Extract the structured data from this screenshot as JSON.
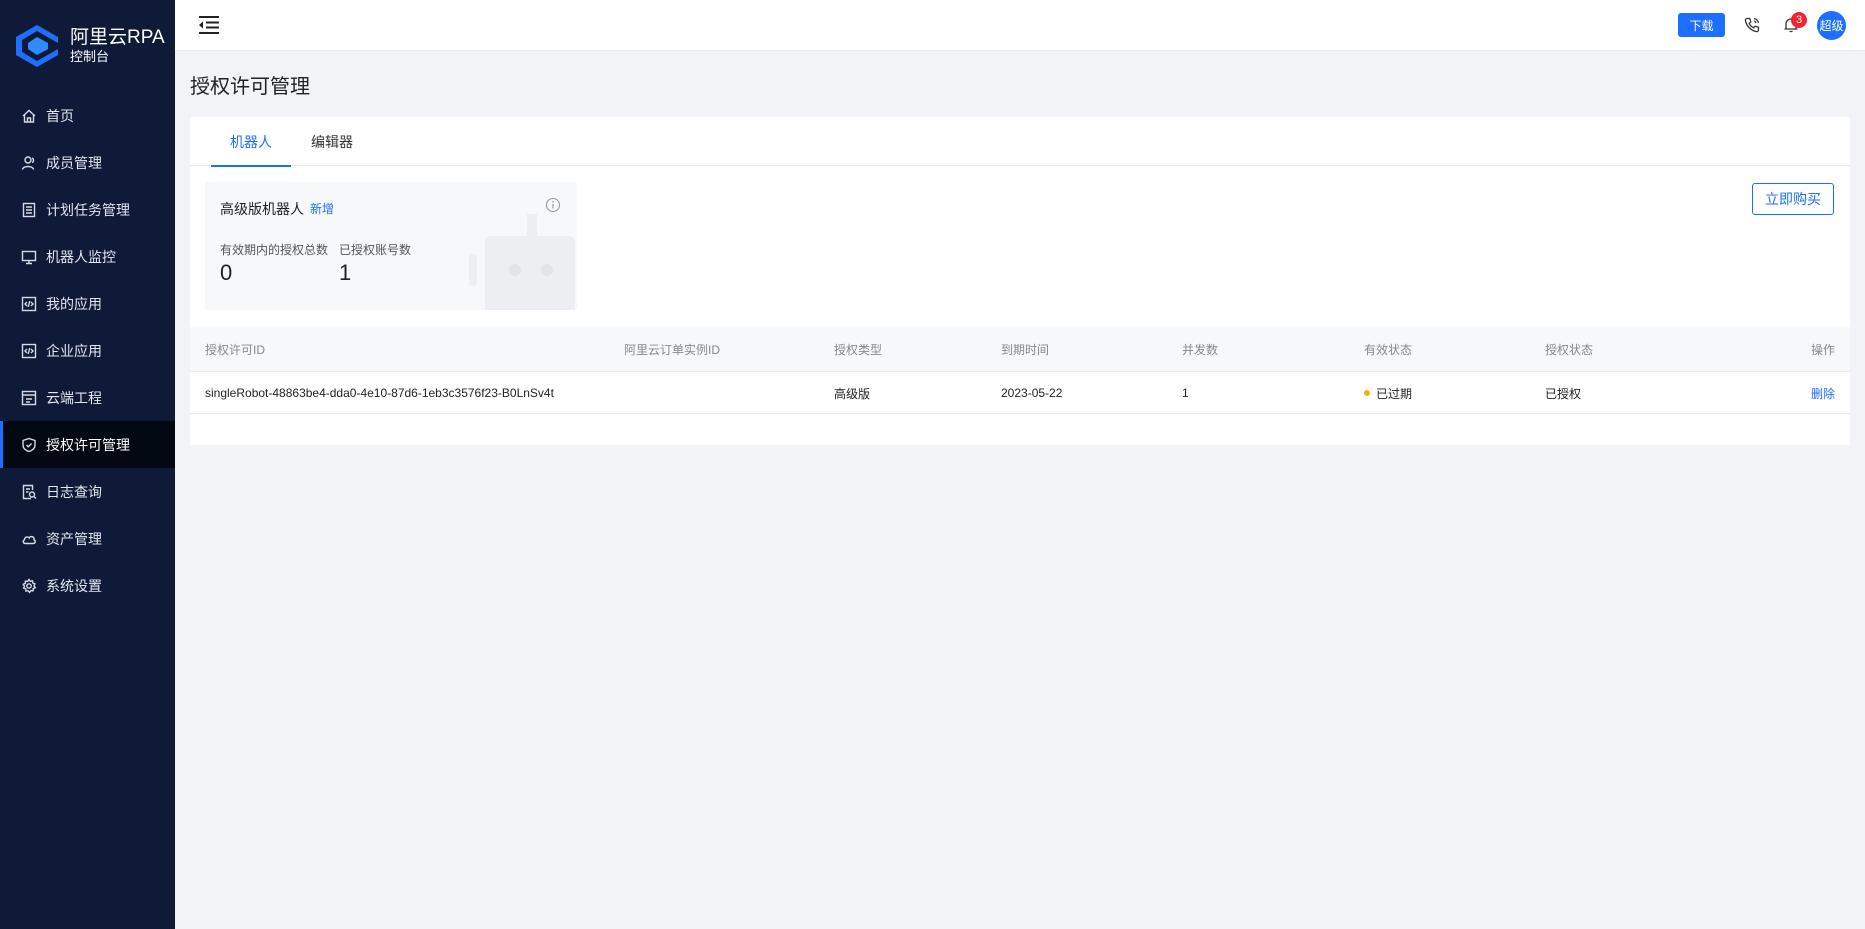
{
  "brand": {
    "title": "阿里云RPA",
    "subtitle": "控制台"
  },
  "sidebar": {
    "items": [
      {
        "label": "首页",
        "icon": "home-icon"
      },
      {
        "label": "成员管理",
        "icon": "user-icon"
      },
      {
        "label": "计划任务管理",
        "icon": "list-icon"
      },
      {
        "label": "机器人监控",
        "icon": "monitor-icon"
      },
      {
        "label": "我的应用",
        "icon": "code-icon"
      },
      {
        "label": "企业应用",
        "icon": "code-icon"
      },
      {
        "label": "云端工程",
        "icon": "cloud-project-icon"
      },
      {
        "label": "授权许可管理",
        "icon": "shield-icon",
        "active": true
      },
      {
        "label": "日志查询",
        "icon": "log-search-icon"
      },
      {
        "label": "资产管理",
        "icon": "cloud-icon"
      },
      {
        "label": "系统设置",
        "icon": "gear-icon"
      }
    ]
  },
  "header": {
    "download_label": "下载",
    "badge_count": "3",
    "avatar_label": "超级"
  },
  "page": {
    "title": "授权许可管理",
    "tabs": [
      {
        "label": "机器人",
        "active": true
      },
      {
        "label": "编辑器",
        "active": false
      }
    ],
    "buy_label": "立即购买"
  },
  "stat_card": {
    "title": "高级版机器人",
    "new_label": "新增",
    "label_total": "有效期内的授权总数",
    "label_accounts": "已授权账号数",
    "value_total": "0",
    "value_accounts": "1"
  },
  "table": {
    "columns": [
      "授权许可ID",
      "阿里云订单实例ID",
      "授权类型",
      "到期时间",
      "并发数",
      "有效状态",
      "授权状态",
      "操作"
    ],
    "rows": [
      {
        "license_id": "singleRobot-48863be4-dda0-4e10-87d6-1eb3c3576f23-B0LnSv4t",
        "order_id": "",
        "type": "高级版",
        "expire": "2023-05-22",
        "concurrency": "1",
        "valid_status": "已过期",
        "auth_status": "已授权",
        "action": "删除"
      }
    ]
  },
  "colors": {
    "accent": "#1e6fff",
    "sidebar_bg": "#0e1a38",
    "warning": "#faad14",
    "badge": "#f5222d"
  }
}
